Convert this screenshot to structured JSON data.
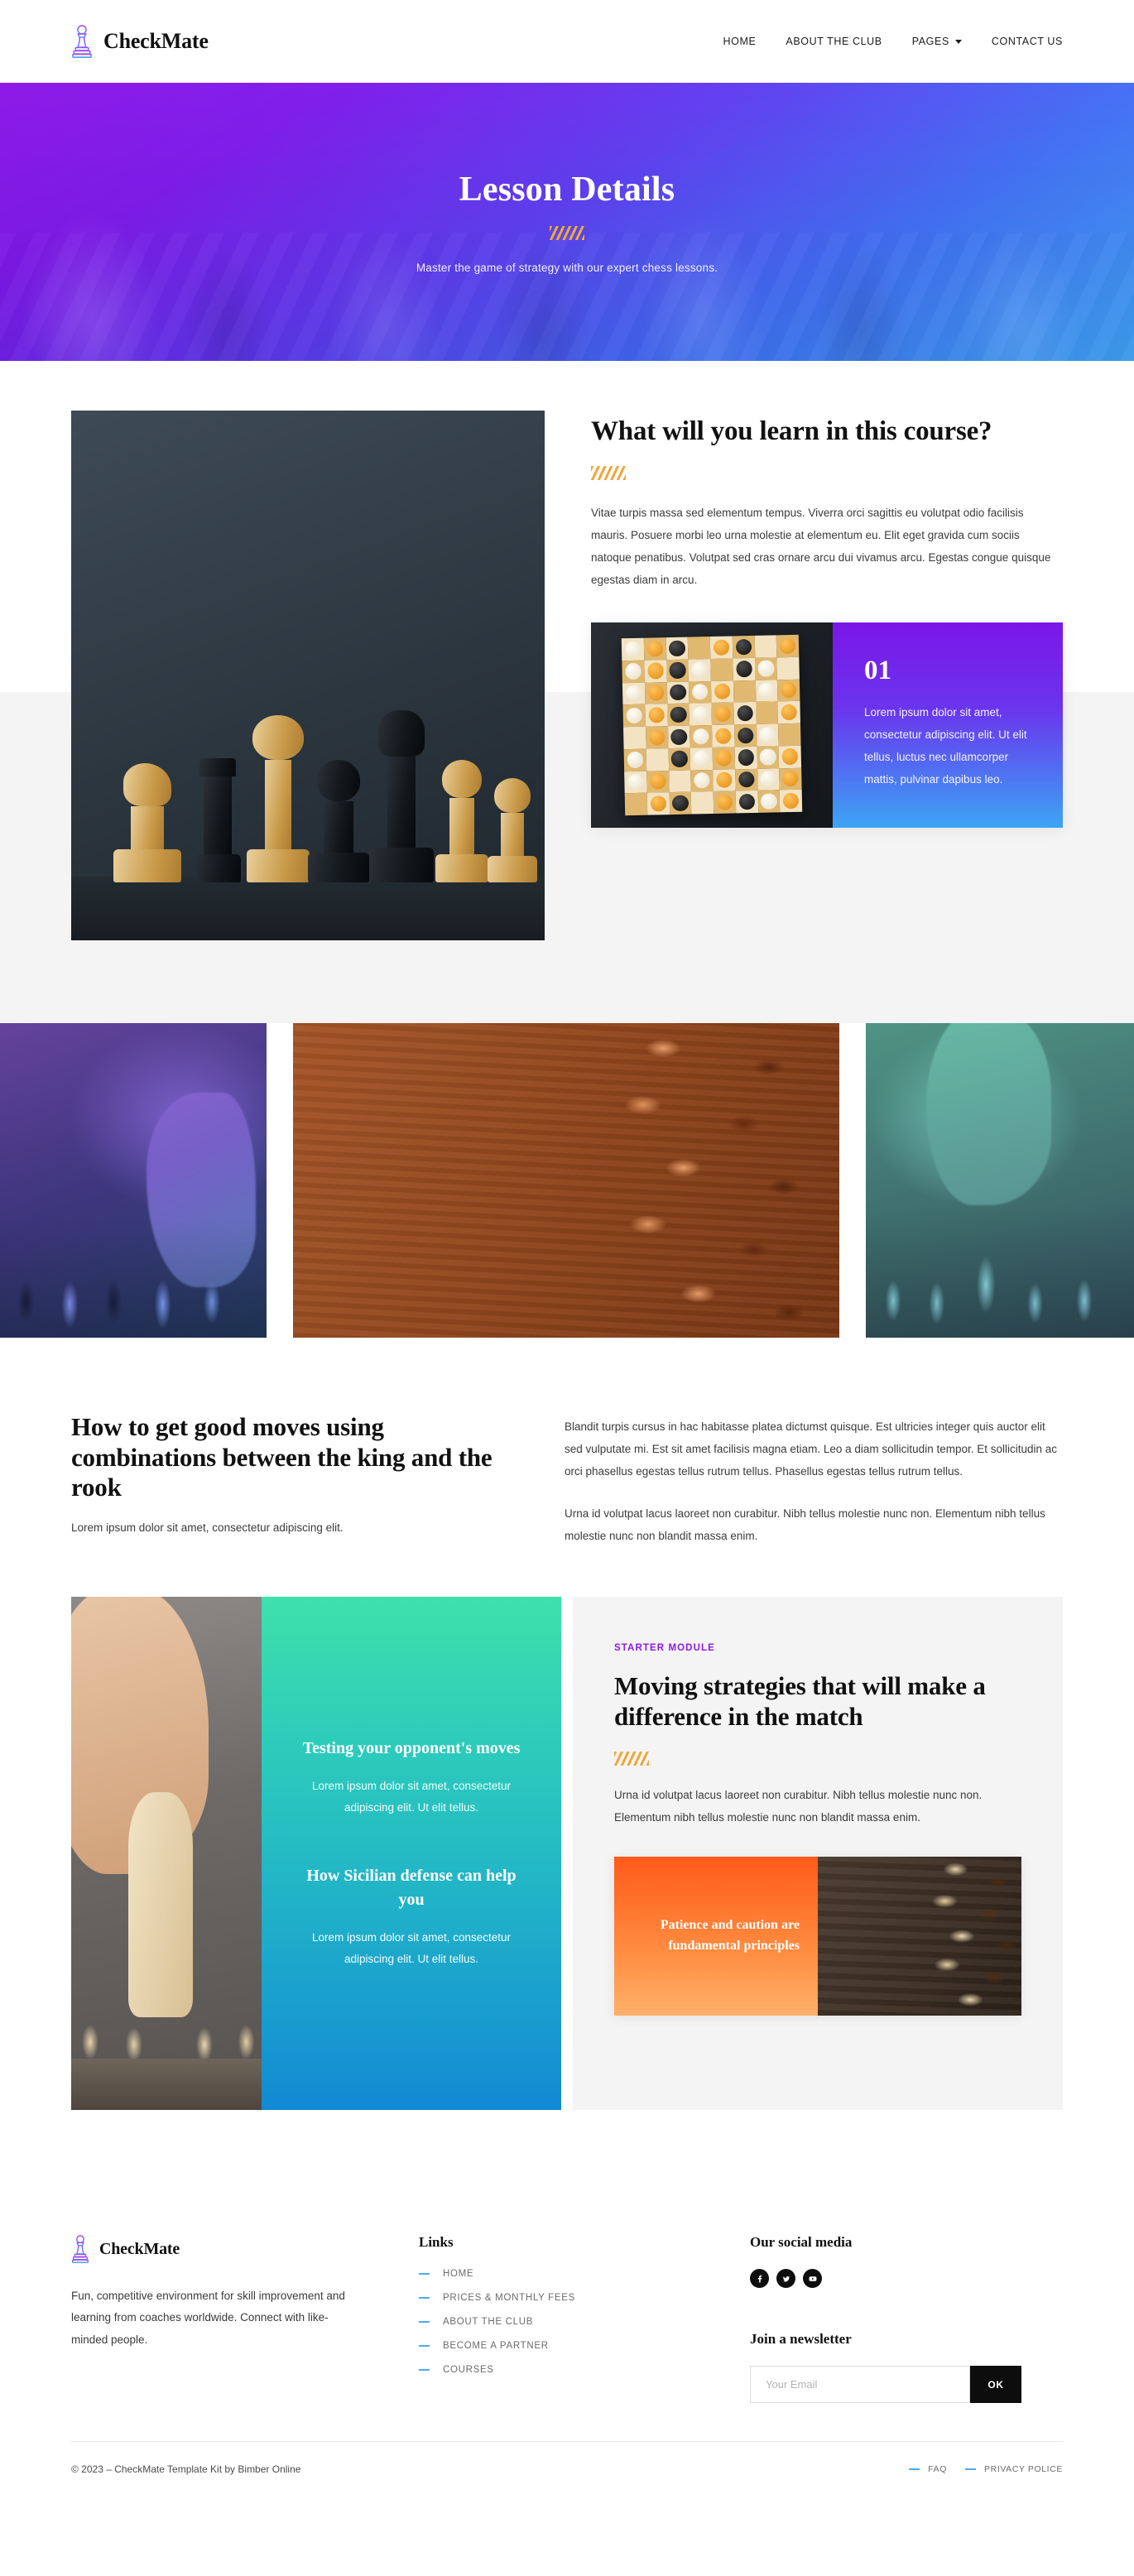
{
  "header": {
    "brand": "CheckMate",
    "logo_icon": "chess-pawn-icon",
    "nav": [
      {
        "label": "HOME",
        "has_caret": false
      },
      {
        "label": "ABOUT THE CLUB",
        "has_caret": false
      },
      {
        "label": "PAGES",
        "has_caret": true
      },
      {
        "label": "CONTACT US",
        "has_caret": false
      }
    ]
  },
  "hero": {
    "title": "Lesson Details",
    "subtitle": "Master the game of strategy with our expert chess lessons."
  },
  "learn": {
    "heading": "What will you learn in this course?",
    "paragraph": "Vitae turpis massa sed elementum tempus. Viverra orci sagittis eu volutpat odio facilisis mauris. Posuere morbi leo urna molestie at elementum eu. Elit eget gravida cum sociis natoque penatibus. Volutpat sed cras ornare arcu dui vivamus arcu. Egestas congue quisque egestas diam in arcu.",
    "image_alt": "chess-pieces-photo",
    "card": {
      "number": "01",
      "text": "Lorem ipsum dolor sit amet, consectetur adipiscing elit. Ut elit tellus, luctus nec ullamcorper mattis, pulvinar dapibus leo.",
      "image_alt": "chessboard-top-view-photo",
      "gradient_from": "#7B16E8",
      "gradient_to": "#3DA5F4"
    }
  },
  "gallery": [
    {
      "alt": "hand-over-chessboard-photo",
      "tint": "#6A46F2"
    },
    {
      "alt": "scattered-chess-pieces-photo",
      "tint": "#E8621F"
    },
    {
      "alt": "hand-moving-piece-photo",
      "tint": "#2FD8A8"
    }
  ],
  "moves": {
    "heading": "How to get good moves using combinations between the king and the rook",
    "subheading": "Lorem ipsum dolor sit amet, consectetur adipiscing elit.",
    "paragraphs": [
      "Blandit turpis cursus in hac habitasse platea dictumst quisque. Est ultricies integer quis auctor elit sed vulputate mi. Est sit amet facilisis magna etiam. Leo a diam sollicitudin tempor. Et sollicitudin ac orci phasellus egestas tellus rutrum tellus. Phasellus egestas tellus rutrum tellus.",
      "Urna id volutpat lacus laoreet non curabitur. Nibh tellus molestie nunc non. Elementum nibh tellus molestie nunc non blandit massa enim."
    ]
  },
  "panels": {
    "photo_alt": "hand-moving-white-pawn-photo",
    "teal_gradient_from": "#3EE0AB",
    "teal_gradient_to": "#1389D4",
    "teal_blocks": [
      {
        "title": "Testing your opponent's moves",
        "text": "Lorem ipsum dolor sit amet, consectetur adipiscing elit. Ut elit tellus."
      },
      {
        "title": "How Sicilian defense can help you",
        "text": "Lorem ipsum dolor sit amet, consectetur adipiscing elit. Ut elit tellus."
      }
    ],
    "right": {
      "eyebrow": "STARTER MODULE",
      "eyebrow_color": "#8B1AE8",
      "heading": "Moving strategies that will make a difference in the match",
      "paragraph": "Urna id volutpat lacus laoreet non curabitur. Nibh tellus molestie nunc non. Elementum nibh tellus molestie nunc non blandit massa enim.",
      "card": {
        "title": "Patience and caution are fundamental principles",
        "image_alt": "fallen-chess-pieces-on-wood-photo",
        "gradient_from": "#FF5A1A",
        "gradient_to": "#FFB06A"
      }
    }
  },
  "footer": {
    "brand": "CheckMate",
    "logo_icon": "chess-pawn-icon",
    "description": "Fun, competitive environment for skill improvement and learning from coaches worldwide. Connect with like-minded people.",
    "links_heading": "Links",
    "links": [
      "HOME",
      "PRICES & MONTHLY FEES",
      "ABOUT THE CLUB",
      "BECOME A PARTNER",
      "COURSES"
    ],
    "social_heading": "Our social media",
    "socials": [
      {
        "name": "facebook-icon"
      },
      {
        "name": "twitter-icon"
      },
      {
        "name": "youtube-icon"
      }
    ],
    "newsletter_heading": "Join a newsletter",
    "newsletter_placeholder": "Your Email",
    "newsletter_value": "",
    "newsletter_button": "OK",
    "copyright": "© 2023 – CheckMate Template Kit by Bimber Online",
    "bottom_links": [
      "FAQ",
      "PRIVACY POLICE"
    ]
  }
}
